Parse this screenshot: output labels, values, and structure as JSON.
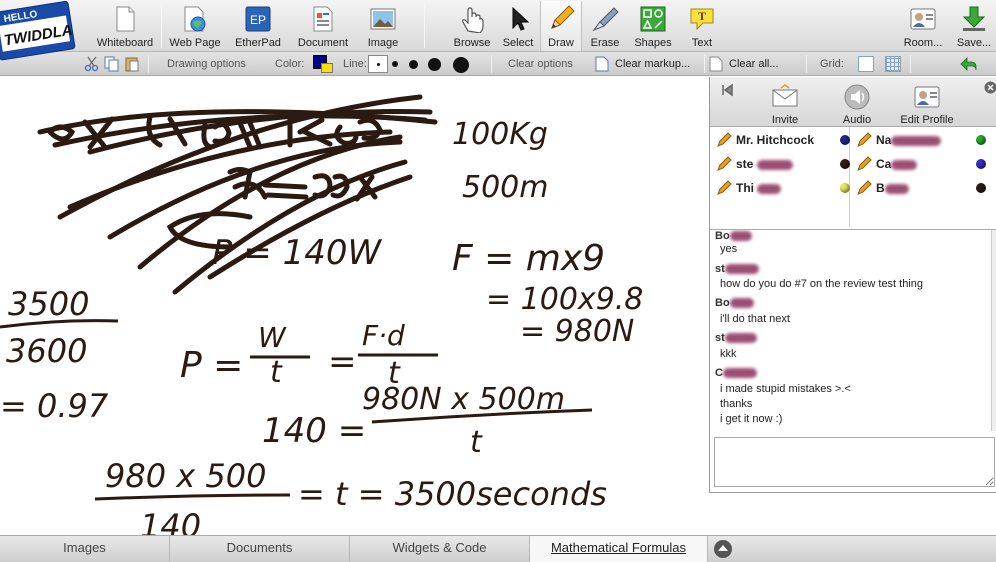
{
  "logo": {
    "line1": "HELLO",
    "line2": "TWIDDLA"
  },
  "toolbar": {
    "tools": [
      {
        "id": "whiteboard",
        "label": "Whiteboard"
      },
      {
        "id": "webpage",
        "label": "Web Page"
      },
      {
        "id": "etherpad",
        "label": "EtherPad",
        "badge": "EP"
      },
      {
        "id": "document",
        "label": "Document"
      },
      {
        "id": "image",
        "label": "Image"
      },
      {
        "id": "browse",
        "label": "Browse"
      },
      {
        "id": "select",
        "label": "Select"
      },
      {
        "id": "draw",
        "label": "Draw"
      },
      {
        "id": "erase",
        "label": "Erase"
      },
      {
        "id": "shapes",
        "label": "Shapes"
      },
      {
        "id": "text",
        "label": "Text",
        "badge": "T"
      },
      {
        "id": "room",
        "label": "Room..."
      },
      {
        "id": "save",
        "label": "Save..."
      }
    ],
    "active_tool": "draw"
  },
  "options": {
    "drawing_options": "Drawing options",
    "color_label": "Color:",
    "line_label": "Line:",
    "clear_options": "Clear options",
    "clear_markup": "Clear markup...",
    "clear_all": "Clear all...",
    "grid_label": "Grid:",
    "selected_color": "#000080"
  },
  "whiteboard": {
    "ink_color": "#2a1a12",
    "equations": [
      {
        "id": "mass",
        "text": "100Kg"
      },
      {
        "id": "height",
        "text": "500m"
      },
      {
        "id": "power",
        "text": "P = 140W"
      },
      {
        "id": "force",
        "text": "F = mx9"
      },
      {
        "id": "force2",
        "text": "= 100x9.8"
      },
      {
        "id": "force3",
        "text": "= 980N"
      },
      {
        "id": "frac-num",
        "text": "3500"
      },
      {
        "id": "frac-den",
        "text": "3600"
      },
      {
        "id": "frac-res",
        "text": "= 0.97"
      },
      {
        "id": "formula-p",
        "text": "P ="
      },
      {
        "id": "formula-w",
        "text": "W"
      },
      {
        "id": "formula-t1",
        "text": "t"
      },
      {
        "id": "formula-eq",
        "text": "="
      },
      {
        "id": "formula-fd",
        "text": "F·d"
      },
      {
        "id": "formula-t2",
        "text": "t"
      },
      {
        "id": "eq-140",
        "text": "140 ="
      },
      {
        "id": "eq-num",
        "text": "980N x 500m"
      },
      {
        "id": "eq-t",
        "text": "t"
      },
      {
        "id": "final-num",
        "text": "980 x 500"
      },
      {
        "id": "final-den",
        "text": "140"
      },
      {
        "id": "final-res",
        "text": "= t = 3500seconds"
      }
    ]
  },
  "bottom_tabs": [
    {
      "id": "images",
      "label": "Images"
    },
    {
      "id": "documents",
      "label": "Documents"
    },
    {
      "id": "widgets",
      "label": "Widgets & Code"
    },
    {
      "id": "math",
      "label": "Mathematical Formulas"
    }
  ],
  "panel": {
    "invite": "Invite",
    "audio": "Audio",
    "edit_profile": "Edit Profile",
    "users_left": [
      {
        "name": "Mr. Hitchcock",
        "dot": "#1a2a8a"
      },
      {
        "name": "ste",
        "dot": "#3a1a1a"
      },
      {
        "name": "Thi",
        "dot": "#e8e85a"
      }
    ],
    "users_right": [
      {
        "name": "Na",
        "dot": "#2aa82a"
      },
      {
        "name": "Ca",
        "dot": "#3a2ac8"
      },
      {
        "name": "B",
        "dot": "#2a1a1a"
      }
    ]
  },
  "chat": {
    "messages": [
      {
        "author": "Bo",
        "lines": [
          "yes"
        ]
      },
      {
        "author": "st",
        "lines": [
          "how do you do #7 on the review test thing"
        ]
      },
      {
        "author": "Bo",
        "lines": [
          "i'll do that next"
        ]
      },
      {
        "author": "st",
        "lines": [
          "kkk"
        ]
      },
      {
        "author": "C",
        "lines": [
          "i made stupid mistakes >.<",
          "thanks",
          "i get it now :)"
        ]
      }
    ]
  }
}
